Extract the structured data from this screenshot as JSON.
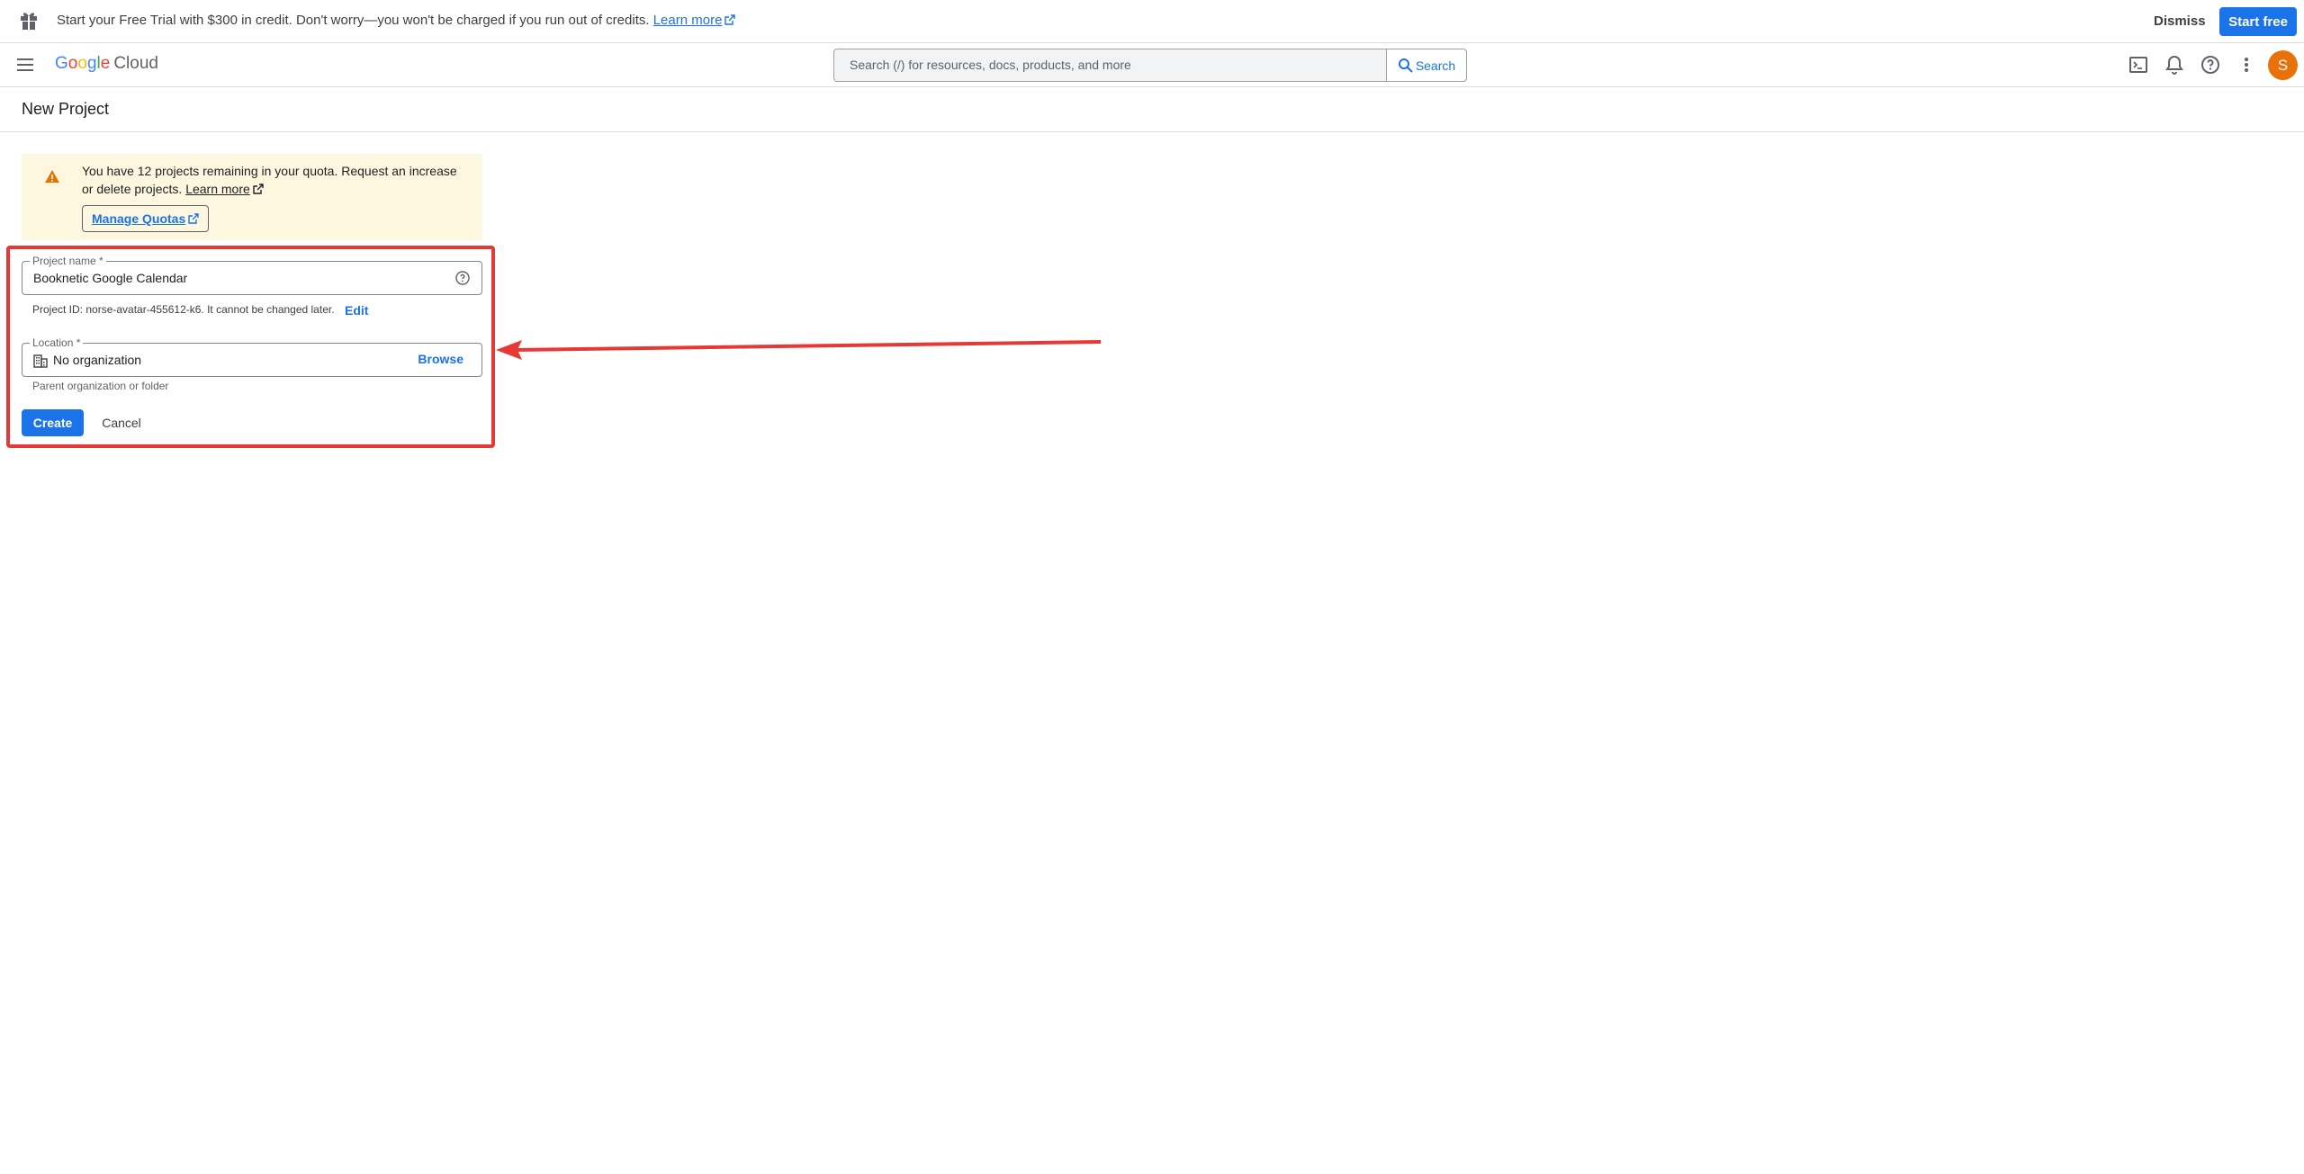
{
  "banner": {
    "message": "Start your Free Trial with $300 in credit. Don't worry—you won't be charged if you run out of credits.",
    "learn_more": "Learn more",
    "dismiss": "Dismiss",
    "start_free": "Start free"
  },
  "appbar": {
    "logo_google": "Google",
    "logo_cloud": "Cloud",
    "search_placeholder": "Search (/) for resources, docs, products, and more",
    "search_button": "Search",
    "avatar_letter": "S"
  },
  "page": {
    "title": "New Project"
  },
  "notice": {
    "text": "You have 12 projects remaining in your quota. Request an increase or delete projects.",
    "learn_more": "Learn more",
    "manage_quotas": "Manage Quotas"
  },
  "form": {
    "project_name_label": "Project name *",
    "project_name_value": "Booknetic Google Calendar",
    "project_id_text": "Project ID: norse-avatar-455612-k6. It cannot be changed later.",
    "edit": "Edit",
    "location_label": "Location *",
    "location_value": "No organization",
    "browse": "Browse",
    "location_hint": "Parent organization or folder",
    "create": "Create",
    "cancel": "Cancel"
  },
  "colors": {
    "primary": "#1a73e8",
    "notice_bg": "#fef7e0",
    "warning": "#e37400",
    "annotation": "#e53935",
    "avatar": "#e8710a"
  }
}
